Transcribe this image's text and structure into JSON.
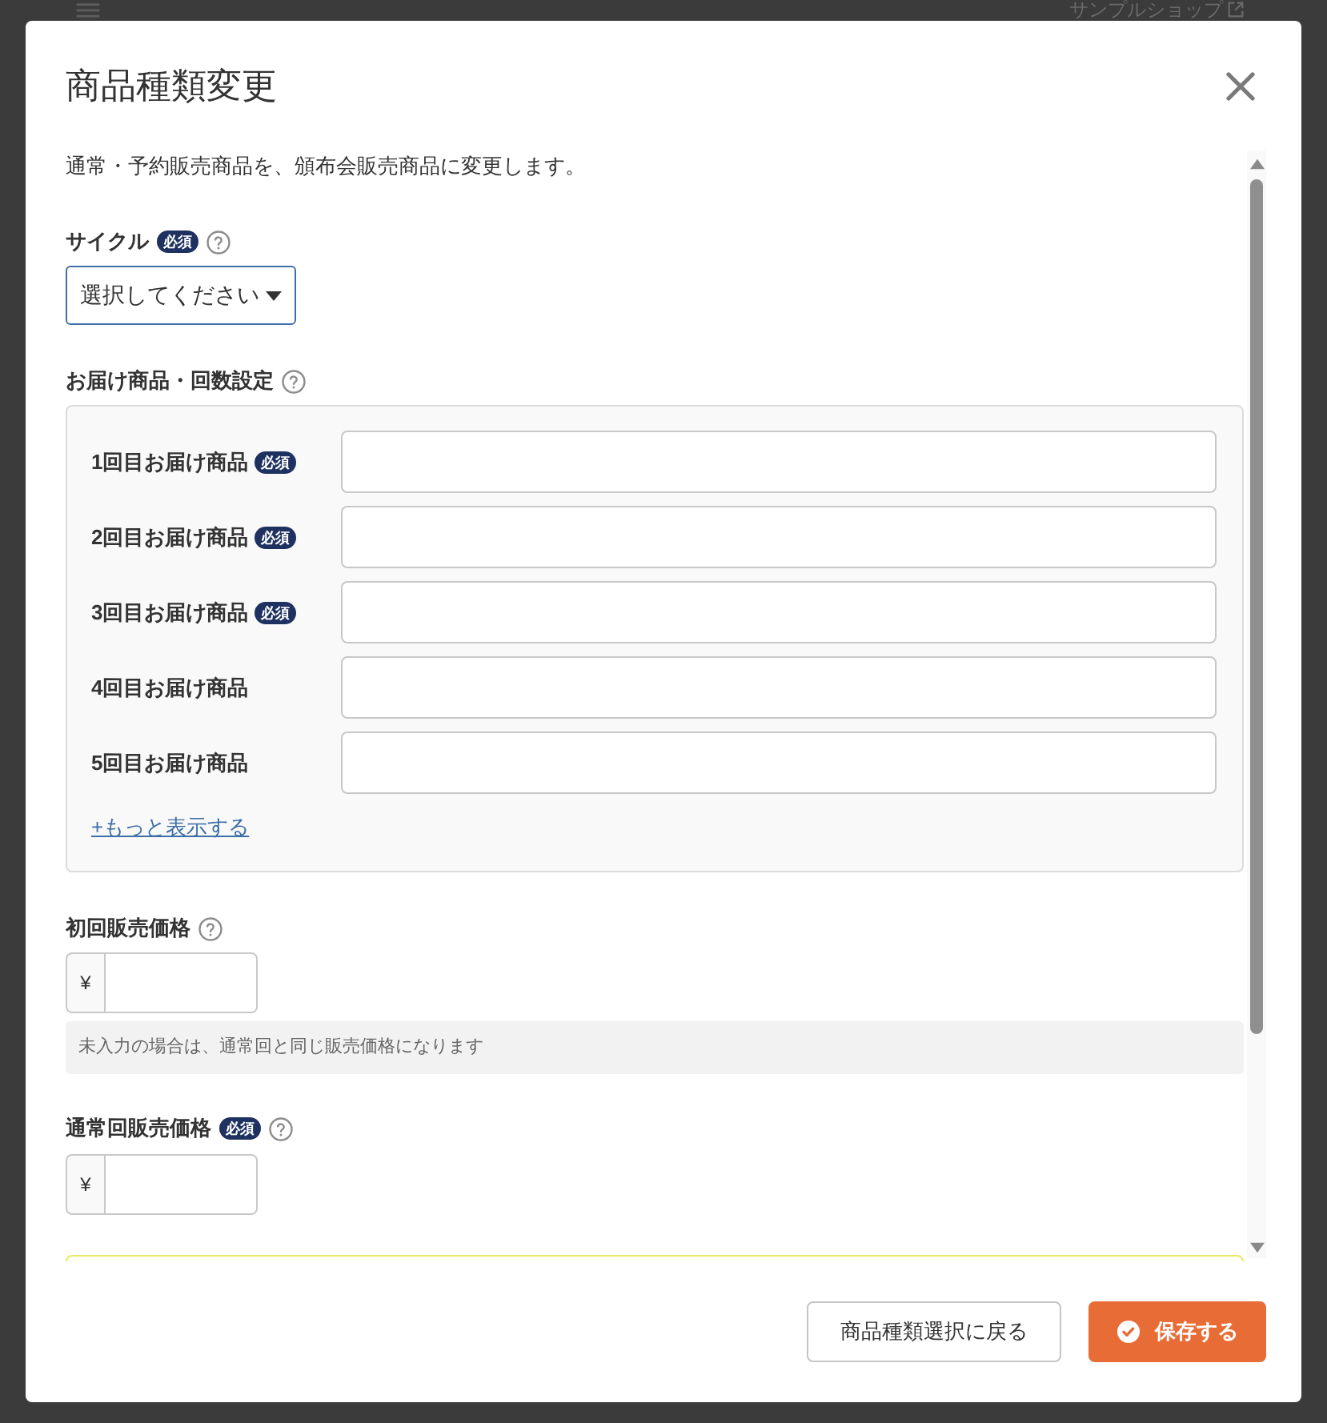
{
  "background_page": {
    "shop_name": "サンプルショップ"
  },
  "dialog": {
    "title": "商品種類変更",
    "description": "通常・予約販売商品を、頒布会販売商品に変更します。",
    "cycle": {
      "label": "サイクル",
      "badge": "必須",
      "select": {
        "value": "選択してください"
      }
    },
    "delivery_settings": {
      "label": "お届け商品・回数設定",
      "rows": [
        {
          "label": "1回目お届け商品",
          "badge": "必須"
        },
        {
          "label": "2回目お届け商品",
          "badge": "必須"
        },
        {
          "label": "3回目お届け商品",
          "badge": "必須"
        },
        {
          "label": "4回目お届け商品"
        },
        {
          "label": "5回目お届け商品"
        }
      ],
      "more_link": "+もっと表示する"
    },
    "first_price": {
      "label": "初回販売価格",
      "currency": "¥",
      "note": "未入力の場合は、通常回と同じ販売価格になります"
    },
    "regular_price": {
      "label": "通常回販売価格",
      "badge": "必須",
      "currency": "¥"
    },
    "buttons": [
      {
        "label": "商品種類選択に戻る",
        "kind": "secondary"
      },
      {
        "label": "保存する",
        "kind": "primary"
      }
    ]
  }
}
